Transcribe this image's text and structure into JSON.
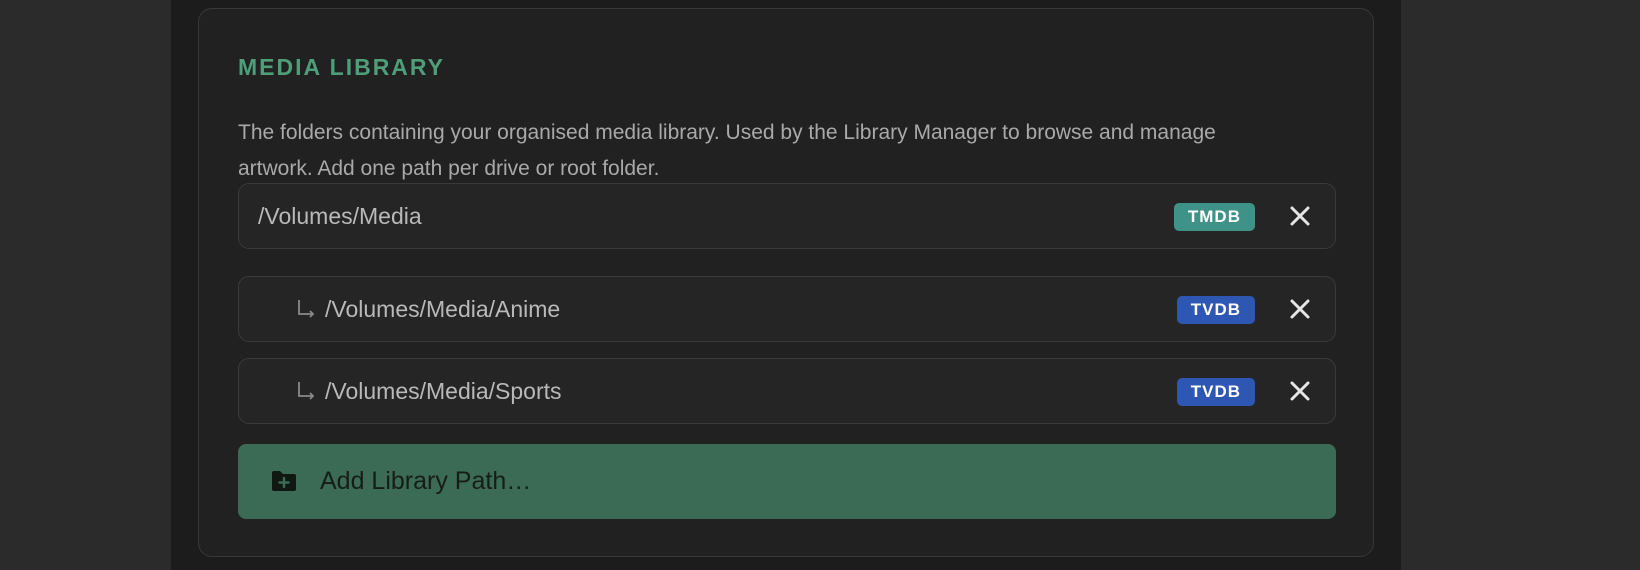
{
  "section": {
    "title": "MEDIA LIBRARY",
    "description": "The folders containing your organised media library. Used by the Library Manager to browse and manage artwork. Add one path per drive or root folder."
  },
  "paths": [
    {
      "path": "/Volumes/Media",
      "source": "TMDB",
      "badge_color": "#3e9287",
      "is_child": false
    },
    {
      "path": "/Volumes/Media/Anime",
      "source": "TVDB",
      "badge_color": "#2e56b3",
      "is_child": true
    },
    {
      "path": "/Volumes/Media/Sports",
      "source": "TVDB",
      "badge_color": "#2e56b3",
      "is_child": true
    }
  ],
  "icons": {
    "remove": "close-icon",
    "child_indicator": "subdirectory-arrow-icon",
    "add": "folder-plus-icon"
  },
  "add_button": {
    "label": "Add Library Path…",
    "color": "#3b6b55"
  },
  "colors": {
    "accent": "#4f9e7a",
    "tmdb": "#3e9287",
    "tvdb": "#2e56b3"
  }
}
